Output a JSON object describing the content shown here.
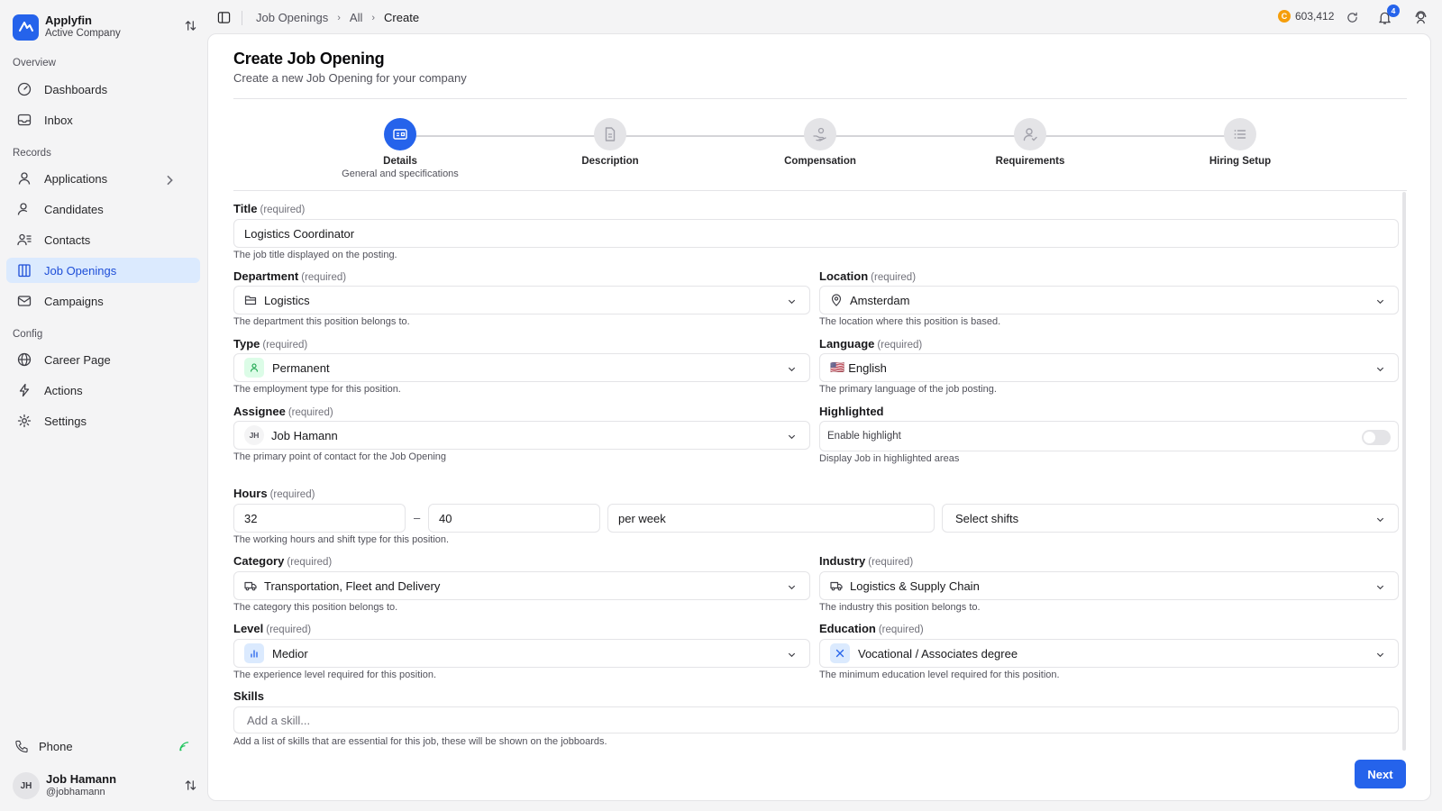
{
  "sidebar": {
    "brand_name": "Applyfin",
    "brand_sub": "Active Company",
    "sections": {
      "overview": "Overview",
      "records": "Records",
      "config": "Config"
    },
    "items": {
      "dashboards": "Dashboards",
      "inbox": "Inbox",
      "applications": "Applications",
      "candidates": "Candidates",
      "contacts": "Contacts",
      "job_openings": "Job Openings",
      "campaigns": "Campaigns",
      "career_page": "Career Page",
      "actions": "Actions",
      "settings": "Settings"
    },
    "phone": "Phone",
    "user": {
      "initials": "JH",
      "name": "Job Hamann",
      "handle": "@jobhamann"
    }
  },
  "topbar": {
    "breadcrumb": [
      "Job Openings",
      "All",
      "Create"
    ],
    "credits": "603,412",
    "coin_symbol": "C",
    "notifications": "4"
  },
  "page": {
    "title": "Create Job Opening",
    "subtitle": "Create a new Job Opening for your company"
  },
  "steps": [
    {
      "label": "Details",
      "sub": "General and specifications"
    },
    {
      "label": "Description"
    },
    {
      "label": "Compensation"
    },
    {
      "label": "Requirements"
    },
    {
      "label": "Hiring Setup"
    }
  ],
  "form": {
    "required": "(required)",
    "title": {
      "label": "Title",
      "value": "Logistics Coordinator",
      "help": "The job title displayed on the posting."
    },
    "department": {
      "label": "Department",
      "value": "Logistics",
      "help": "The department this position belongs to."
    },
    "location": {
      "label": "Location",
      "value": "Amsterdam",
      "help": "The location where this position is based."
    },
    "type": {
      "label": "Type",
      "value": "Permanent",
      "help": "The employment type for this position."
    },
    "language": {
      "label": "Language",
      "flag": "🇺🇸",
      "value": "English",
      "help": "The primary language of the job posting."
    },
    "assignee": {
      "label": "Assignee",
      "initials": "JH",
      "value": "Job Hamann",
      "help": "The primary point of contact for the Job Opening"
    },
    "highlighted": {
      "label": "Highlighted",
      "toggle_label": "Enable highlight",
      "help": "Display Job in highlighted areas"
    },
    "hours": {
      "label": "Hours",
      "min": "32",
      "separator": "–",
      "max": "40",
      "period": "per week",
      "shifts_placeholder": "Select shifts",
      "help": "The working hours and shift type for this position."
    },
    "category": {
      "label": "Category",
      "value": "Transportation, Fleet and Delivery",
      "help": "The category this position belongs to."
    },
    "industry": {
      "label": "Industry",
      "value": "Logistics & Supply Chain",
      "help": "The industry this position belongs to."
    },
    "level": {
      "label": "Level",
      "value": "Medior",
      "help": "The experience level required for this position."
    },
    "education": {
      "label": "Education",
      "value": "Vocational / Associates degree",
      "help": "The minimum education level required for this position."
    },
    "skills": {
      "label": "Skills",
      "placeholder": "Add a skill...",
      "help": "Add a list of skills that are essential for this job, these will be shown on the jobboards."
    }
  },
  "actions": {
    "next": "Next"
  },
  "colors": {
    "accent": "#2563eb",
    "active_nav_bg": "#dbeafe",
    "coin": "#f59e0b"
  }
}
